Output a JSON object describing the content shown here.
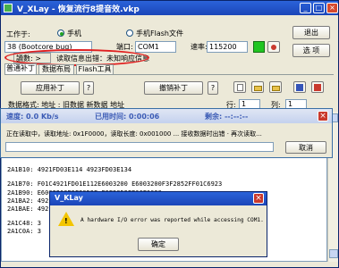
{
  "window": {
    "title": "V_XLay - 恢复流行8提音效.vkp"
  },
  "top": {
    "workmode_label": "工作于:",
    "radio_phone": "手机",
    "radio_flash": "手机Flash文件",
    "exit_label": "退出",
    "device": "38 (Bootcore bug)",
    "port_label": "端口:",
    "port": "COM1",
    "baud_label": "速率:",
    "baud": "115200",
    "options_label": "选 项",
    "status_read": "讀數: >",
    "status_info": "读取信息出错：未知响应信息"
  },
  "tabs": [
    "普通补丁",
    "数据布局",
    "Flash工具"
  ],
  "actions": {
    "apply": "应用补丁",
    "help": "?",
    "undo": "撤销补丁"
  },
  "row": {
    "data_text": "数据格式: 地址 : 旧数据 新数据 地址",
    "line_label": "行:",
    "line_value": "1",
    "col_label": "列:",
    "col_value": "1"
  },
  "log": [
    "2A1B10: 4921FD03E114 4923FD03E134",
    "2A1B70: F01C4921FD01E112E6003200 E6003200F3F2852FF01C6923",
    "2A1B90: E6003200F3F2852F F3F2852FE6CF0038",
    "2A1BA2: 4921FD03E114 4923FD03E134",
    "2A1BAE: 4921FD03E114 4923FD03E134",
    "2A1C48: 3",
    "2A1C0A: 3"
  ],
  "progress": {
    "speed": "速度: 0.0 Kb/s",
    "elapsed": "已用时间: 0:00:06",
    "remaining": "剩余: --:--:--",
    "message": "正在读取中，读取地址: 0x1F0000，读取长度: 0x001000 ... 接收数据时出错 · 再次读取...",
    "cancel": "取消"
  },
  "error": {
    "title": "V_KLay",
    "message": "A hardware I/O error was reported while accessing COM1.",
    "ok": "确定"
  },
  "colors": {
    "titlebar": "#1b45b8",
    "green_button": "#21c521",
    "error_icon": "#f3c500",
    "close": "#c9392d"
  }
}
